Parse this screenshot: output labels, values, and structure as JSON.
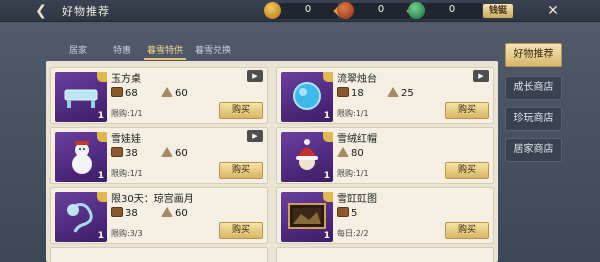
{
  "header": {
    "back_icon": "back-arrow-icon",
    "title": "好物推荐",
    "currencies": [
      {
        "icon": "gold-ingot-icon",
        "value": "0",
        "color": "#d99a2b"
      },
      {
        "icon": "copper-coin-icon",
        "value": "0",
        "color": "#c2552a"
      },
      {
        "icon": "jade-icon",
        "value": "0",
        "color": "#3f9b5a"
      }
    ],
    "exchange_label": "钱铤",
    "close_icon": "close-icon"
  },
  "subtabs": [
    "居家",
    "特惠",
    "暮雪特供",
    "暮雪兑换"
  ],
  "active_subtab": 2,
  "sidetabs": [
    "好物推荐",
    "成长商店",
    "珍玩商店",
    "居家商店"
  ],
  "active_sidetab": 0,
  "items": [
    {
      "name": "玉方桌",
      "count": "1",
      "price_chest": "68",
      "price_cone": "60",
      "limit": "限购:1/1",
      "buy": "购买",
      "video": true
    },
    {
      "name": "流翠烛台",
      "count": "1",
      "price_chest": "18",
      "price_cone": "25",
      "limit": "限购:1/1",
      "buy": "购买",
      "video": true
    },
    {
      "name": "雪娃娃",
      "count": "1",
      "price_chest": "38",
      "price_cone": "60",
      "limit": "限购:1/1",
      "buy": "购买",
      "video": true
    },
    {
      "name": "雪绒红帽",
      "count": "1",
      "price_chest": "",
      "price_cone": "80",
      "limit": "限购:1/1",
      "buy": "购买",
      "video": false
    },
    {
      "name": "限30天：琼宫画月",
      "count": "1",
      "price_chest": "38",
      "price_cone": "60",
      "limit": "限购:3/3",
      "buy": "购买",
      "video": false
    },
    {
      "name": "雪豇豇图",
      "count": "1",
      "price_chest": "5",
      "price_cone": "",
      "limit": "每日:2/2",
      "buy": "购买",
      "video": false
    }
  ]
}
